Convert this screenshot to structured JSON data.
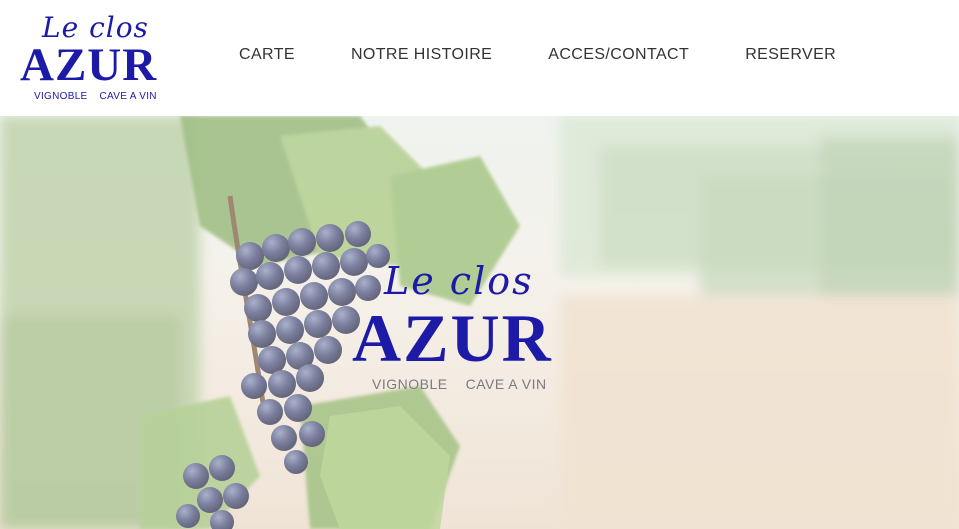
{
  "logo": {
    "script": "Le clos",
    "brand": "AZUR",
    "tag_left": "VIGNOBLE",
    "tag_right": "CAVE A VIN"
  },
  "nav": {
    "items": [
      {
        "label": "CARTE"
      },
      {
        "label": "NOTRE HISTOIRE"
      },
      {
        "label": "ACCES/CONTACT"
      },
      {
        "label": "RESERVER"
      }
    ]
  },
  "hero": {
    "script": "Le clos",
    "brand": "AZUR",
    "tag_left": "VIGNOBLE",
    "tag_right": "CAVE A VIN",
    "background_image": "vineyard-grapes"
  },
  "colors": {
    "brand_blue": "#1c1aa6",
    "nav_text": "#333333"
  }
}
